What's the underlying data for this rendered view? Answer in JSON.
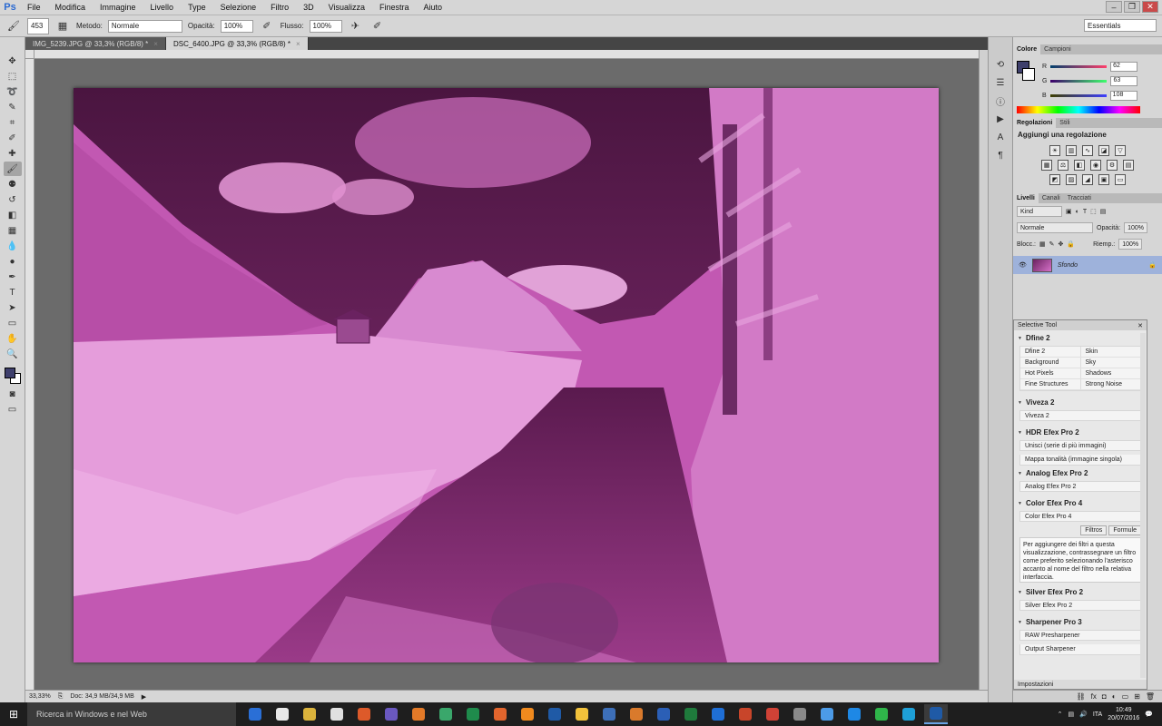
{
  "app": {
    "logo": "Ps"
  },
  "menu": [
    "File",
    "Modifica",
    "Immagine",
    "Livello",
    "Type",
    "Selezione",
    "Filtro",
    "3D",
    "Visualizza",
    "Finestra",
    "Aiuto"
  ],
  "window_buttons": {
    "minimize": "–",
    "restore": "❐",
    "close": "✕"
  },
  "options": {
    "brush_size": "453",
    "mode_label": "Metodo:",
    "mode_value": "Normale",
    "opacity_label": "Opacità:",
    "opacity_value": "100%",
    "flow_label": "Flusso:",
    "flow_value": "100%",
    "workspace": "Essentials"
  },
  "tabs": [
    {
      "label": "IMG_5239.JPG @ 33,3% (RGB/8) *",
      "active": false
    },
    {
      "label": "DSC_6400.JPG @ 33,3% (RGB/8) *",
      "active": true
    }
  ],
  "tab_close": "×",
  "tools": [
    "move",
    "marquee",
    "lasso",
    "quick-select",
    "crop",
    "eyedropper",
    "healing",
    "brush",
    "stamp",
    "history-brush",
    "eraser",
    "gradient",
    "blur",
    "dodge",
    "pen",
    "type",
    "path-select",
    "shape",
    "hand",
    "zoom"
  ],
  "tool_glyphs": [
    "✥",
    "⬚",
    "➰",
    "✎",
    "⌗",
    "✐",
    "✚",
    "🖌",
    "⚉",
    "↺",
    "◧",
    "▦",
    "💧",
    "●",
    "✒",
    "T",
    "➤",
    "▭",
    "✋",
    "🔍"
  ],
  "colors": {
    "foreground": "#3e3f6c",
    "background": "#ffffff",
    "image_fill": "#c860b8",
    "accent": "#9eb2db"
  },
  "status": {
    "zoom": "33,33%",
    "doc": "Doc: 34,9 MB/34,9 MB",
    "arrow": "▶"
  },
  "color_panel": {
    "tabs": [
      "Colore",
      "Campioni"
    ],
    "r_label": "R",
    "r": "62",
    "g_label": "G",
    "g": "63",
    "b_label": "B",
    "b": "108"
  },
  "adjustments": {
    "tabs": [
      "Regolazioni",
      "Stili"
    ],
    "title": "Aggiungi una regolazione"
  },
  "layers": {
    "tabs": [
      "Livelli",
      "Canali",
      "Tracciati"
    ],
    "kind": "Kind",
    "blend": "Normale",
    "opacity_label": "Opacità:",
    "opacity": "100%",
    "lock_label": "Blocc.:",
    "fill_label": "Riemp.:",
    "fill": "100%",
    "layer_name": "Sfondo"
  },
  "selective": {
    "title": "Selective Tool",
    "dfine": {
      "title": "Dfine 2",
      "grid": [
        [
          "Dfine 2",
          "Skin"
        ],
        [
          "Background",
          "Sky"
        ],
        [
          "Hot Pixels",
          "Shadows"
        ],
        [
          "Fine Structures",
          "Strong Noise"
        ]
      ]
    },
    "viveza": {
      "title": "Viveza 2",
      "items": [
        "Viveza 2"
      ]
    },
    "hdr": {
      "title": "HDR Efex Pro 2",
      "items": [
        "Unisci (serie di più immagini)",
        "Mappa tonalità (immagine singola)"
      ]
    },
    "analog": {
      "title": "Analog Efex Pro 2",
      "items": [
        "Analog Efex Pro 2"
      ]
    },
    "color": {
      "title": "Color Efex Pro 4",
      "items": [
        "Color Efex Pro 4"
      ],
      "subtabs": [
        "Filtros",
        "Formule"
      ],
      "note": "Per aggiungere dei filtri a questa visualizzazione, contrassegnare un filtro come preferito selezionando l'asterisco accanto al nome del filtro nella relativa interfaccia."
    },
    "silver": {
      "title": "Silver Efex Pro 2",
      "items": [
        "Silver Efex Pro 2"
      ]
    },
    "sharpener": {
      "title": "Sharpener Pro 3",
      "items": [
        "RAW Presharpener",
        "Output Sharpener"
      ]
    },
    "footer": "Impostazioni"
  },
  "taskbar": {
    "start": "⊞",
    "search_placeholder": "Ricerca in Windows e nel Web",
    "app_colors": [
      "#2a6fd6",
      "#e8e8e8",
      "#dbb33c",
      "#e0e0e0",
      "#dd5a2a",
      "#6a58c0",
      "#e37a28",
      "#3aa76b",
      "#1f8b4c",
      "#e2652d",
      "#f08a1e",
      "#1f5aa6",
      "#f2c23b",
      "#3d6fb8",
      "#d97a2c",
      "#2b5fb6",
      "#1f7a3c",
      "#1f6fd6",
      "#c8452a",
      "#d04236",
      "#8a8a8a",
      "#4c9be8",
      "#1e88e5",
      "#2fb54a",
      "#1ea0d8",
      "#1f5aa6"
    ],
    "language": "ITA",
    "time": "10:49",
    "date": "20/07/2016"
  }
}
